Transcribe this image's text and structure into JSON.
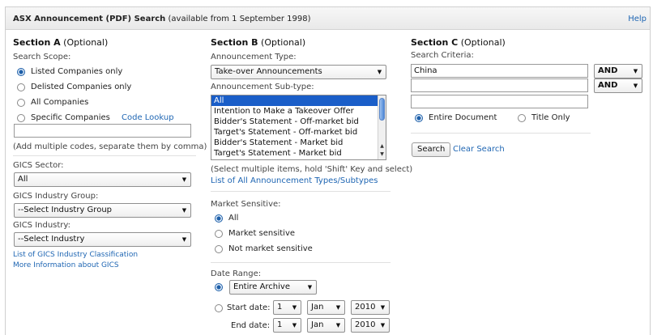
{
  "title": {
    "bold": "ASX Announcement (PDF) Search",
    "rest": " (available from 1 September 1998)"
  },
  "help_label": "Help",
  "section_a": {
    "heading": "Section A",
    "optional": " (Optional)",
    "scope_label": "Search Scope:",
    "scope_options": [
      "Listed Companies only",
      "Delisted Companies only",
      "All Companies",
      "Specific Companies"
    ],
    "scope_selected": 0,
    "code_lookup": "Code Lookup",
    "codes_value": "",
    "codes_hint": "(Add multiple codes, separate them by comma)",
    "gics_sector_label": "GICS Sector:",
    "gics_sector_value": "All",
    "gics_group_label": "GICS Industry Group:",
    "gics_group_value": "--Select Industry Group",
    "gics_industry_label": "GICS Industry:",
    "gics_industry_value": "--Select Industry",
    "gics_list_link": "List of GICS Industry Classification",
    "gics_more_link": "More Information about GICS"
  },
  "section_b": {
    "heading": "Section B",
    "optional": " (Optional)",
    "type_label": "Announcement Type:",
    "type_value": "Take-over Announcements",
    "subtype_label": "Announcement Sub-type:",
    "subtypes": [
      "All",
      "Intention to Make a Takeover Offer",
      "Bidder's Statement - Off-market bid",
      "Target's Statement - Off-market bid",
      "Bidder's Statement - Market bid",
      "Target's Statement - Market bid"
    ],
    "subtype_selected": 0,
    "multi_hint": "(Select multiple items, hold 'Shift' Key and select)",
    "all_types_link": "List of All Announcement Types/Subtypes",
    "market_label": "Market Sensitive:",
    "market_options": [
      "All",
      "Market sensitive",
      "Not market sensitive"
    ],
    "market_selected": 0,
    "date_label": "Date Range:",
    "archive_value": "Entire Archive",
    "start_label": "Start date:",
    "end_label": "End date:",
    "start": {
      "day": "1",
      "month": "Jan",
      "year": "2010"
    },
    "end": {
      "day": "1",
      "month": "Jan",
      "year": "2010"
    },
    "date_mode": "archive"
  },
  "section_c": {
    "heading": "Section C",
    "optional": " (Optional)",
    "criteria_label": "Search Criteria:",
    "criteria": [
      "China",
      "",
      ""
    ],
    "operators": [
      "AND",
      "AND"
    ],
    "scope_options": [
      "Entire Document",
      "Title Only"
    ],
    "scope_selected": 0,
    "search_button": "Search",
    "clear_link": "Clear Search"
  },
  "colors": {
    "link": "#1f66b3",
    "selection": "#1a5ec8",
    "radio": "#1e5fa8"
  }
}
